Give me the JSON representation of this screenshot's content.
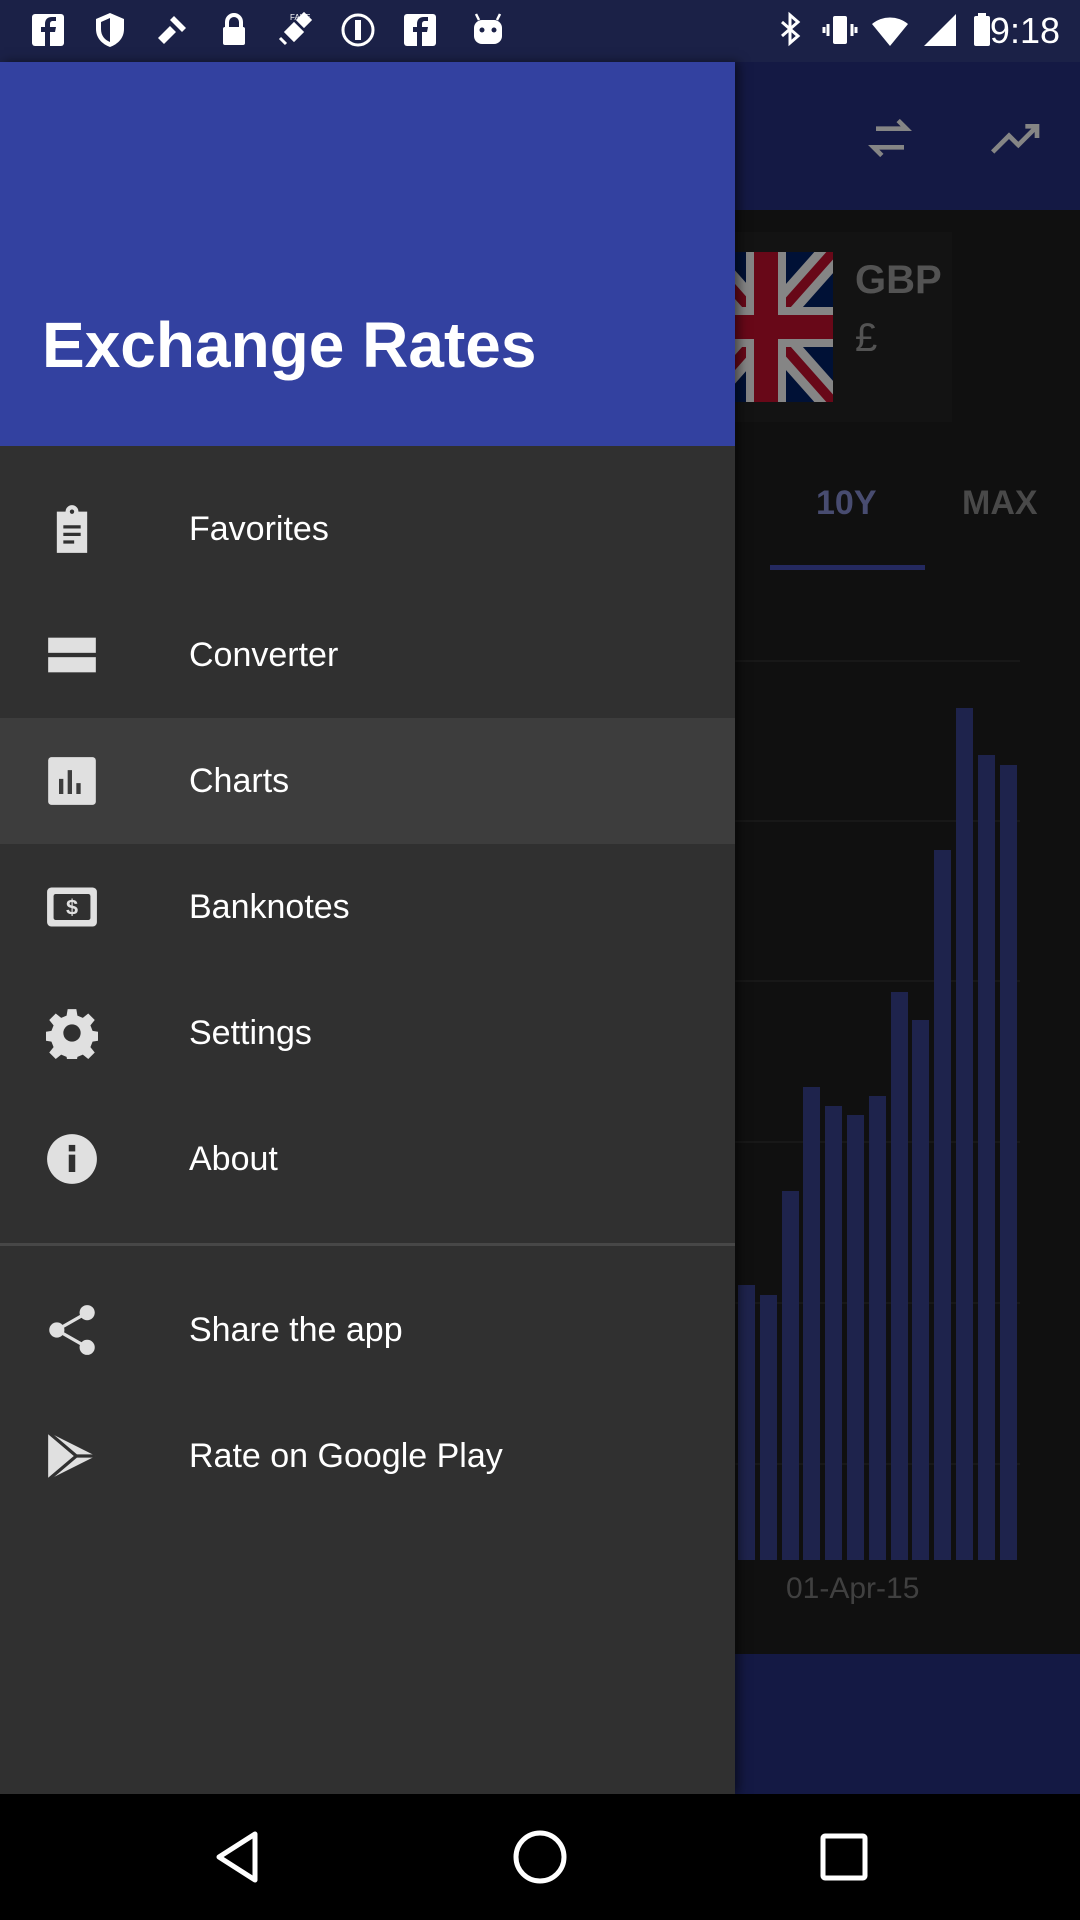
{
  "status_bar": {
    "time": "9:18",
    "left_icons": [
      "facebook-icon",
      "shield-icon",
      "tool-icon",
      "lock-icon",
      "satellite-fake-gps-icon",
      "record-icon",
      "facebook-icon",
      "android-icon"
    ],
    "right_icons": [
      "bluetooth-icon",
      "vibrate-icon",
      "wifi-icon",
      "signal-icon",
      "battery-icon"
    ]
  },
  "app": {
    "toolbar_icons": [
      "swap-icon",
      "trending-up-icon"
    ],
    "currency": {
      "code": "GBP",
      "symbol": "£"
    },
    "periods": [
      "10Y",
      "MAX"
    ],
    "selected_period": "10Y",
    "chart_date_label": "01-Apr-15"
  },
  "chart_data": {
    "type": "bar",
    "xlabel": "",
    "ylabel": "",
    "x_tick_labels": [
      "01-Apr-15"
    ],
    "values": [
      0.29,
      0.28,
      0.39,
      0.5,
      0.48,
      0.47,
      0.49,
      0.6,
      0.57,
      0.75,
      0.9,
      0.85,
      0.84
    ],
    "ylim": [
      0,
      0.9
    ],
    "grid": true,
    "color": "#3b4492"
  },
  "drawer": {
    "title": "Exchange Rates",
    "header_color": "#3341a0",
    "items": [
      {
        "label": "Favorites",
        "icon": "clipboard-icon",
        "active": false
      },
      {
        "label": "Converter",
        "icon": "converter-icon",
        "active": false
      },
      {
        "label": "Charts",
        "icon": "bar-chart-icon",
        "active": true
      },
      {
        "label": "Banknotes",
        "icon": "banknote-icon",
        "active": false
      },
      {
        "label": "Settings",
        "icon": "gear-icon",
        "active": false
      },
      {
        "label": "About",
        "icon": "info-icon",
        "active": false
      }
    ],
    "secondary_items": [
      {
        "label": "Share the app",
        "icon": "share-icon"
      },
      {
        "label": "Rate on Google Play",
        "icon": "play-store-icon"
      }
    ]
  },
  "nav_bar": {
    "buttons": [
      "back-icon",
      "home-icon",
      "recents-icon"
    ]
  }
}
